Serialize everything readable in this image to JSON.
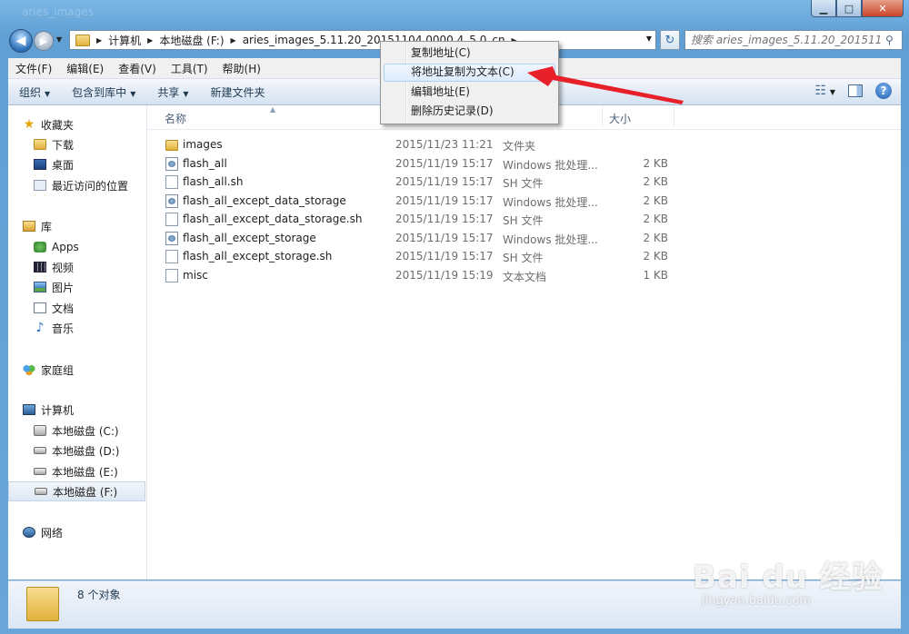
{
  "window": {
    "minimize_label": "▁",
    "maximize_label": "□",
    "close_label": "✕",
    "title_ghost": "aries_images"
  },
  "address": {
    "crumbs": [
      "计算机",
      "本地磁盘 (F:)",
      "aries_images_5.11.20_20151104.0000.4_5.0_cn"
    ],
    "search_placeholder": "搜索 aries_images_5.11.20_201511..."
  },
  "menubar": {
    "items": [
      "文件(F)",
      "编辑(E)",
      "查看(V)",
      "工具(T)",
      "帮助(H)"
    ]
  },
  "toolbar": {
    "organize": "组织",
    "include_library": "包含到库中",
    "share": "共享",
    "new_folder": "新建文件夹"
  },
  "sidebar": {
    "favorites": "收藏夹",
    "downloads": "下载",
    "desktop": "桌面",
    "recent": "最近访问的位置",
    "libraries": "库",
    "apps": "Apps",
    "videos": "视频",
    "pictures": "图片",
    "documents": "文档",
    "music": "音乐",
    "homegroup": "家庭组",
    "computer": "计算机",
    "drive_c": "本地磁盘 (C:)",
    "drive_d": "本地磁盘 (D:)",
    "drive_e": "本地磁盘 (E:)",
    "drive_f": "本地磁盘 (F:)",
    "network": "网络"
  },
  "columns": {
    "name": "名称",
    "size": "大小"
  },
  "files": [
    {
      "name": "images",
      "date": "2015/11/23 11:21",
      "type": "文件夹",
      "size": "",
      "icon": "folder-icon"
    },
    {
      "name": "flash_all",
      "date": "2015/11/19 15:17",
      "type": "Windows 批处理...",
      "size": "2 KB",
      "icon": "batch-file-icon"
    },
    {
      "name": "flash_all.sh",
      "date": "2015/11/19 15:17",
      "type": "SH 文件",
      "size": "2 KB",
      "icon": "file-icon"
    },
    {
      "name": "flash_all_except_data_storage",
      "date": "2015/11/19 15:17",
      "type": "Windows 批处理...",
      "size": "2 KB",
      "icon": "batch-file-icon"
    },
    {
      "name": "flash_all_except_data_storage.sh",
      "date": "2015/11/19 15:17",
      "type": "SH 文件",
      "size": "2 KB",
      "icon": "file-icon"
    },
    {
      "name": "flash_all_except_storage",
      "date": "2015/11/19 15:17",
      "type": "Windows 批处理...",
      "size": "2 KB",
      "icon": "batch-file-icon"
    },
    {
      "name": "flash_all_except_storage.sh",
      "date": "2015/11/19 15:17",
      "type": "SH 文件",
      "size": "2 KB",
      "icon": "file-icon"
    },
    {
      "name": "misc",
      "date": "2015/11/19 15:19",
      "type": "文本文档",
      "size": "1 KB",
      "icon": "file-icon"
    }
  ],
  "status": {
    "count": "8 个对象"
  },
  "context_menu": {
    "items": [
      "复制地址(C)",
      "将地址复制为文本(C)",
      "编辑地址(E)",
      "删除历史记录(D)"
    ],
    "highlighted_index": 1
  },
  "annotation": {
    "arrow_color": "#e8202a"
  },
  "watermark": {
    "main": "Bai du 经验",
    "sub": "jingyan.baidu.com"
  }
}
